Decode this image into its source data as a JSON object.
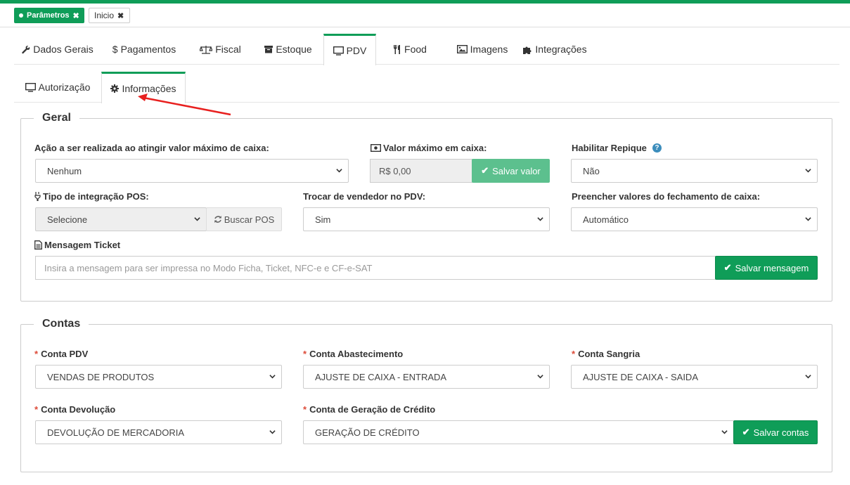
{
  "page_tabs": [
    {
      "label": "Parâmetros",
      "active": true
    },
    {
      "label": "Inicio",
      "active": false
    }
  ],
  "main_tabs": [
    {
      "label": "Dados Gerais",
      "icon": "wrench-icon"
    },
    {
      "label": "Pagamentos",
      "icon": "dollar-icon"
    },
    {
      "label": "Fiscal",
      "icon": "balance-scale-icon"
    },
    {
      "label": "Estoque",
      "icon": "archive-icon"
    },
    {
      "label": "PDV",
      "icon": "monitor-icon",
      "active": true
    },
    {
      "label": "Food",
      "icon": "cutlery-icon"
    },
    {
      "label": "Imagens",
      "icon": "image-icon"
    },
    {
      "label": "Integrações",
      "icon": "puzzle-icon"
    }
  ],
  "sub_tabs": [
    {
      "label": "Autorização",
      "icon": "monitor-icon"
    },
    {
      "label": "Informações",
      "icon": "gear-icon",
      "active": true
    }
  ],
  "geral": {
    "legend": "Geral",
    "acao_label": "Ação a ser realizada ao atingir valor máximo de caixa:",
    "acao_value": "Nenhum",
    "valor_max_label": "Valor máximo em caixa:",
    "valor_max_value": "R$ 0,00",
    "salvar_valor": "Salvar valor",
    "repique_label": "Habilitar Repique",
    "repique_value": "Não",
    "pos_label": "Tipo de integração POS:",
    "pos_value": "Selecione",
    "buscar_pos": "Buscar POS",
    "trocar_label": "Trocar de vendedor no PDV:",
    "trocar_value": "Sim",
    "preencher_label": "Preencher valores do fechamento de caixa:",
    "preencher_value": "Automático",
    "mensagem_label": "Mensagem Ticket",
    "mensagem_placeholder": "Insira a mensagem para ser impressa no Modo Ficha, Ticket, NFC-e e CF-e-SAT",
    "salvar_mensagem": "Salvar mensagem"
  },
  "contas": {
    "legend": "Contas",
    "pdv_label": "Conta PDV",
    "pdv_value": "VENDAS DE PRODUTOS",
    "abastecimento_label": "Conta Abastecimento",
    "abastecimento_value": "AJUSTE DE CAIXA - ENTRADA",
    "sangria_label": "Conta Sangria",
    "sangria_value": "AJUSTE DE CAIXA - SAIDA",
    "devolucao_label": "Conta Devolução",
    "devolucao_value": "DEVOLUÇÃO DE MERCADORIA",
    "credito_label": "Conta de Geração de Crédito",
    "credito_value": "GERAÇÃO DE CRÉDITO",
    "salvar_contas": "Salvar contas"
  },
  "colors": {
    "accent": "#0f9d58",
    "required": "#dd4b39",
    "annotation": "#e8201f"
  }
}
